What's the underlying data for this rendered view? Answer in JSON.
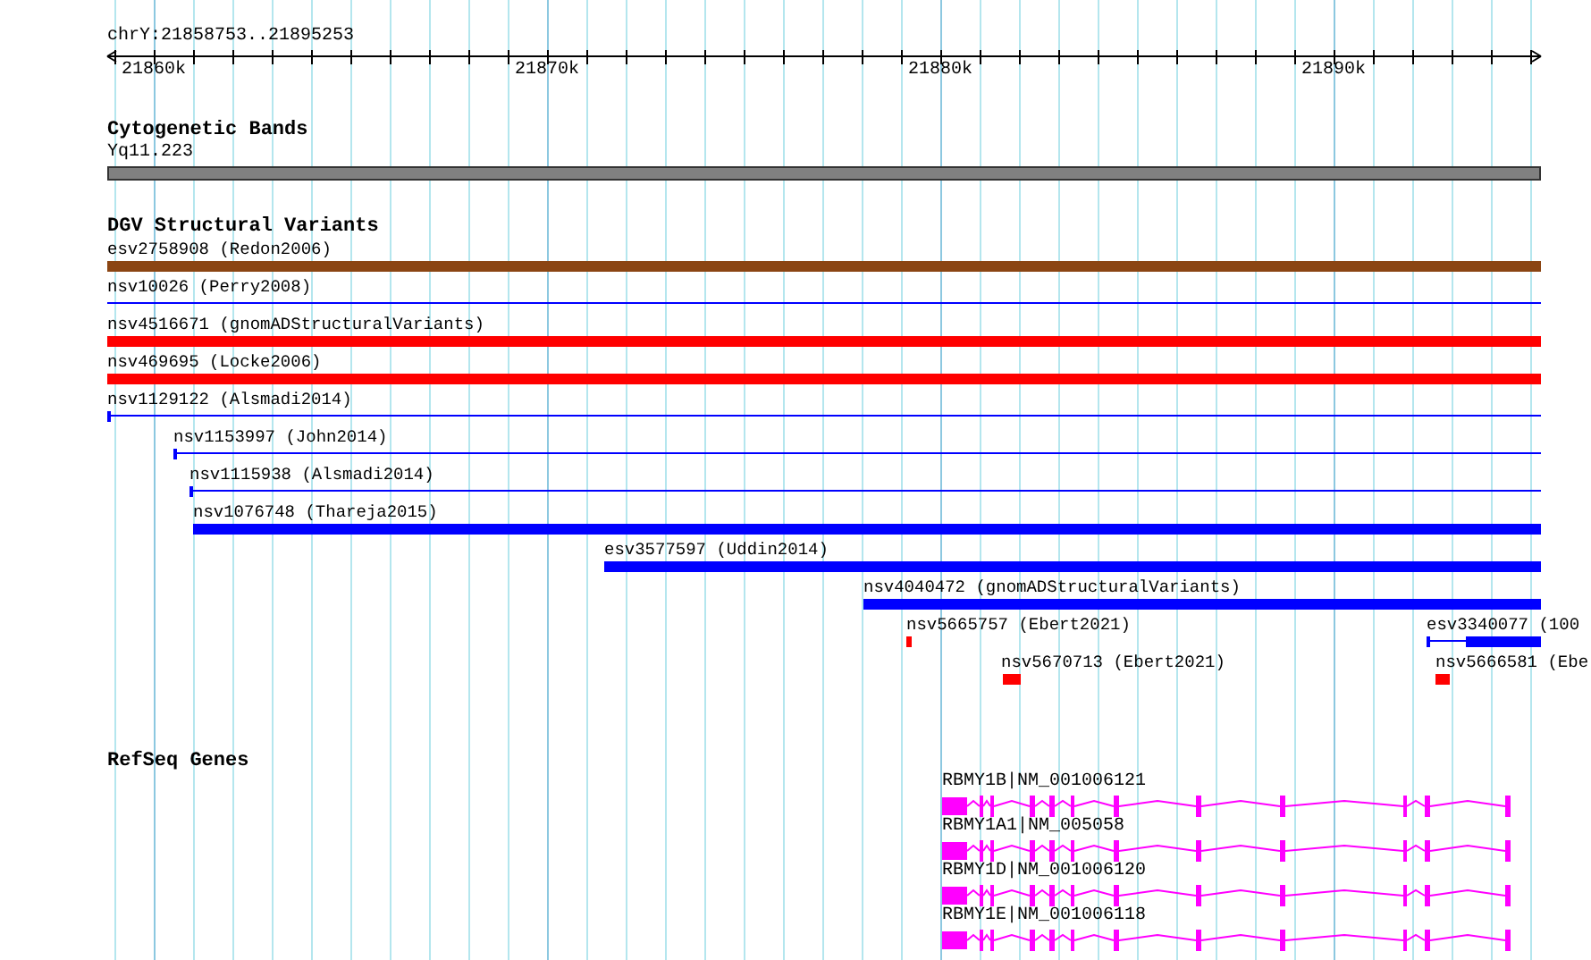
{
  "ruler": {
    "location": "chrY:21858753..21895253",
    "ticks": [
      "21860k",
      "21870k",
      "21880k",
      "21890k"
    ]
  },
  "cytogenetic_bands": {
    "title": "Cytogenetic Bands",
    "bands": [
      {
        "label": "Yq11.223",
        "color": "#808080"
      }
    ]
  },
  "variants": {
    "title": "DGV Structural Variants",
    "features": [
      {
        "label": "esv2758908 (Redon2006)",
        "kind": "bar",
        "color": "#8b4513"
      },
      {
        "label": "nsv10026 (Perry2008)",
        "kind": "line",
        "color": "#0000ff"
      },
      {
        "label": "nsv4516671 (gnomADStructuralVariants)",
        "kind": "bar",
        "color": "#ff0000"
      },
      {
        "label": "nsv469695 (Locke2006)",
        "kind": "bar",
        "color": "#ff0000"
      },
      {
        "label": "nsv1129122 (Alsmadi2014)",
        "kind": "line",
        "color": "#0000ff"
      },
      {
        "label": "nsv1153997 (John2014)",
        "kind": "line",
        "color": "#0000ff"
      },
      {
        "label": "nsv1115938 (Alsmadi2014)",
        "kind": "line",
        "color": "#0000ff"
      },
      {
        "label": "nsv1076748 (Thareja2015)",
        "kind": "bar",
        "color": "#0000ff"
      },
      {
        "label": "esv3577597 (Uddin2014)",
        "kind": "bar",
        "color": "#0000ff"
      },
      {
        "label": "nsv4040472 (gnomADStructuralVariants)",
        "kind": "bar",
        "color": "#0000ff"
      },
      {
        "label": "nsv5665757 (Ebert2021)",
        "kind": "bar",
        "color": "#ff0000"
      },
      {
        "label": "esv3340077 (100",
        "kind": "split",
        "color": "#0000ff"
      },
      {
        "label": "nsv5670713 (Ebert2021)",
        "kind": "bar",
        "color": "#ff0000"
      },
      {
        "label": "nsv5666581 (Ebe",
        "kind": "bar",
        "color": "#ff0000"
      }
    ]
  },
  "genes": {
    "title": "RefSeq Genes",
    "features": [
      {
        "label": "RBMY1B|NM_001006121",
        "color": "#ff00ff"
      },
      {
        "label": "RBMY1A1|NM_005058",
        "color": "#ff00ff"
      },
      {
        "label": "RBMY1D|NM_001006120",
        "color": "#ff00ff"
      },
      {
        "label": "RBMY1E|NM_001006118",
        "color": "#ff00ff"
      }
    ]
  }
}
